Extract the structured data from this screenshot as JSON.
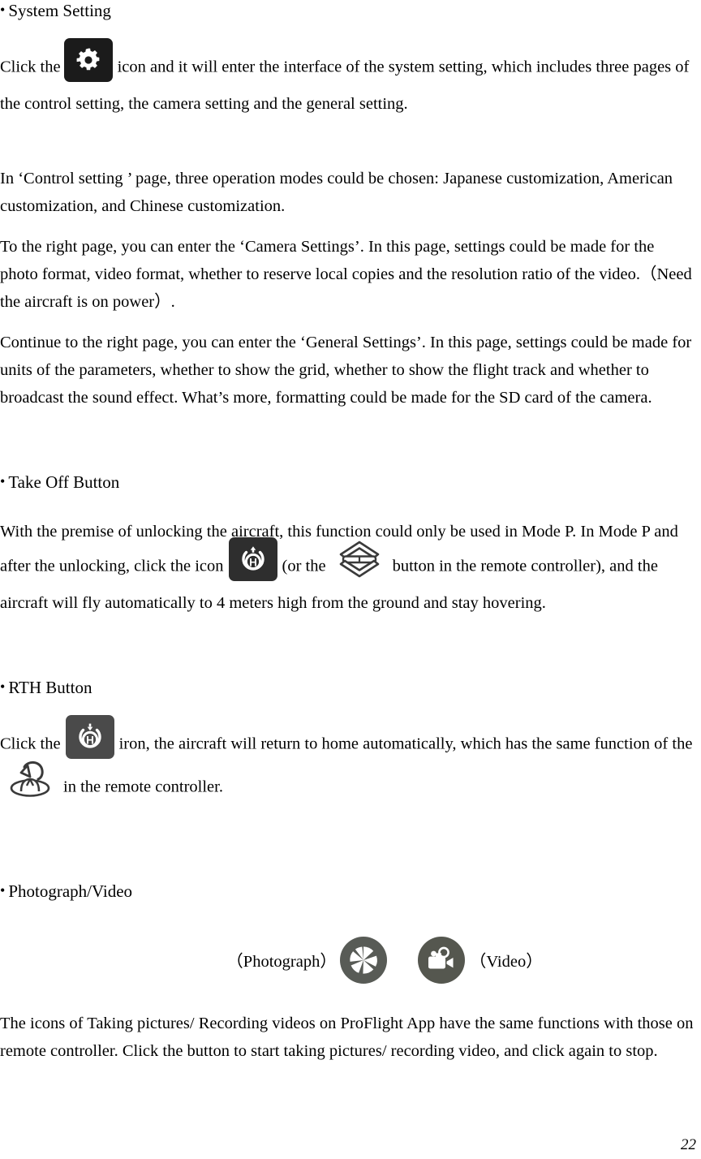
{
  "document": {
    "page_number": "22",
    "colors": {
      "text": "#000000",
      "background": "#ffffff",
      "icon_dark_background": "#2e2e2e",
      "icon_gear_background": "#1b1b1b",
      "icon_round_background": "#585b56",
      "icon_glyph": "#ffffff",
      "icon_outline_stroke": "#3a3a3a"
    }
  },
  "sections": {
    "system_setting": {
      "bullet": "•",
      "heading": "System Setting",
      "icon_name": "gear-icon",
      "paragraph_before_icon": "Click the",
      "paragraph_after_icon": "icon and it will enter the interface of the system setting, which includes three pages of the control setting, the camera setting and the general setting.",
      "paragraph_control": "In ‘Control setting ’ page, three operation modes could be chosen: Japanese customization, American customization, and Chinese customization.",
      "paragraph_camera": "To the right page, you can enter the ‘Camera Settings’. In this page, settings could be made for the photo format, video format, whether to reserve local copies and the resolution ratio of the video.（Need the aircraft is on power）.",
      "paragraph_general": "Continue to the right page, you can enter the ‘General Settings’. In this page, settings could be made for units of the parameters, whether to show the grid, whether to show the flight track and whether to broadcast the sound effect. What’s more, formatting could be made for the SD card of the camera."
    },
    "take_off_button": {
      "bullet": "•",
      "heading": "Take Off Button",
      "paragraph_part1": "With the premise of unlocking the aircraft, this function could only be used in Mode P. In Mode P and after the unlocking, click the icon",
      "icon_takeoff_name": "takeoff-icon",
      "paragraph_part2": "(or the",
      "icon_remote_name": "remote-takeoff-button-icon",
      "paragraph_part3": "button in the remote controller), and the aircraft will fly automatically to 4 meters high from the ground and stay hovering."
    },
    "rth_button": {
      "bullet": "•",
      "heading": "RTH Button",
      "paragraph_part1": "Click the",
      "icon_rth_name": "return-to-home-icon",
      "paragraph_part2": "iron, the aircraft will return to home automatically, which has the same function of the",
      "icon_remote_rth_name": "remote-rth-button-icon",
      "paragraph_part3": "in the remote controller."
    },
    "photograph_video": {
      "bullet": "•",
      "heading": "Photograph/Video",
      "photograph_label": "（Photograph）",
      "photograph_icon_name": "camera-shutter-icon",
      "video_icon_name": "video-camera-icon",
      "video_label": "（Video）",
      "paragraph": "The icons of Taking pictures/ Recording videos on ProFlight App have the same functions with those on remote controller. Click the button to start taking pictures/ recording video, and click again to stop."
    }
  }
}
